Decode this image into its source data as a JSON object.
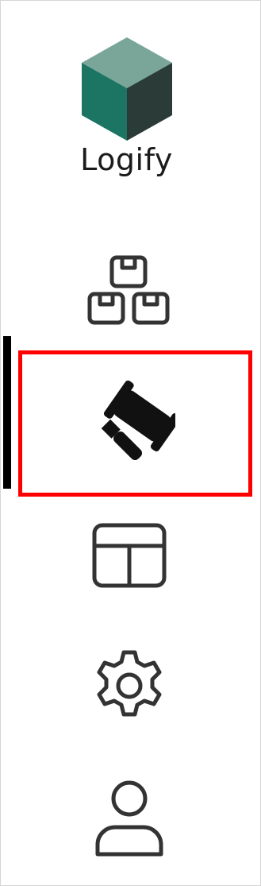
{
  "app": {
    "name": "Logify",
    "logo_icon": "cube-logo-icon",
    "colors": {
      "cube_top": "#7aa69a",
      "cube_left": "#1c7562",
      "cube_right": "#2b3c38",
      "selection": "#ff0000",
      "indicator": "#000000",
      "icon_stroke": "#333333"
    }
  },
  "nav": {
    "items": [
      {
        "id": "inventory",
        "icon": "boxes-icon",
        "selected": false
      },
      {
        "id": "auctions",
        "icon": "gavel-icon",
        "selected": true
      },
      {
        "id": "layout",
        "icon": "layout-icon",
        "selected": false
      },
      {
        "id": "settings",
        "icon": "gear-icon",
        "selected": false
      },
      {
        "id": "profile",
        "icon": "user-icon",
        "selected": false
      }
    ]
  }
}
